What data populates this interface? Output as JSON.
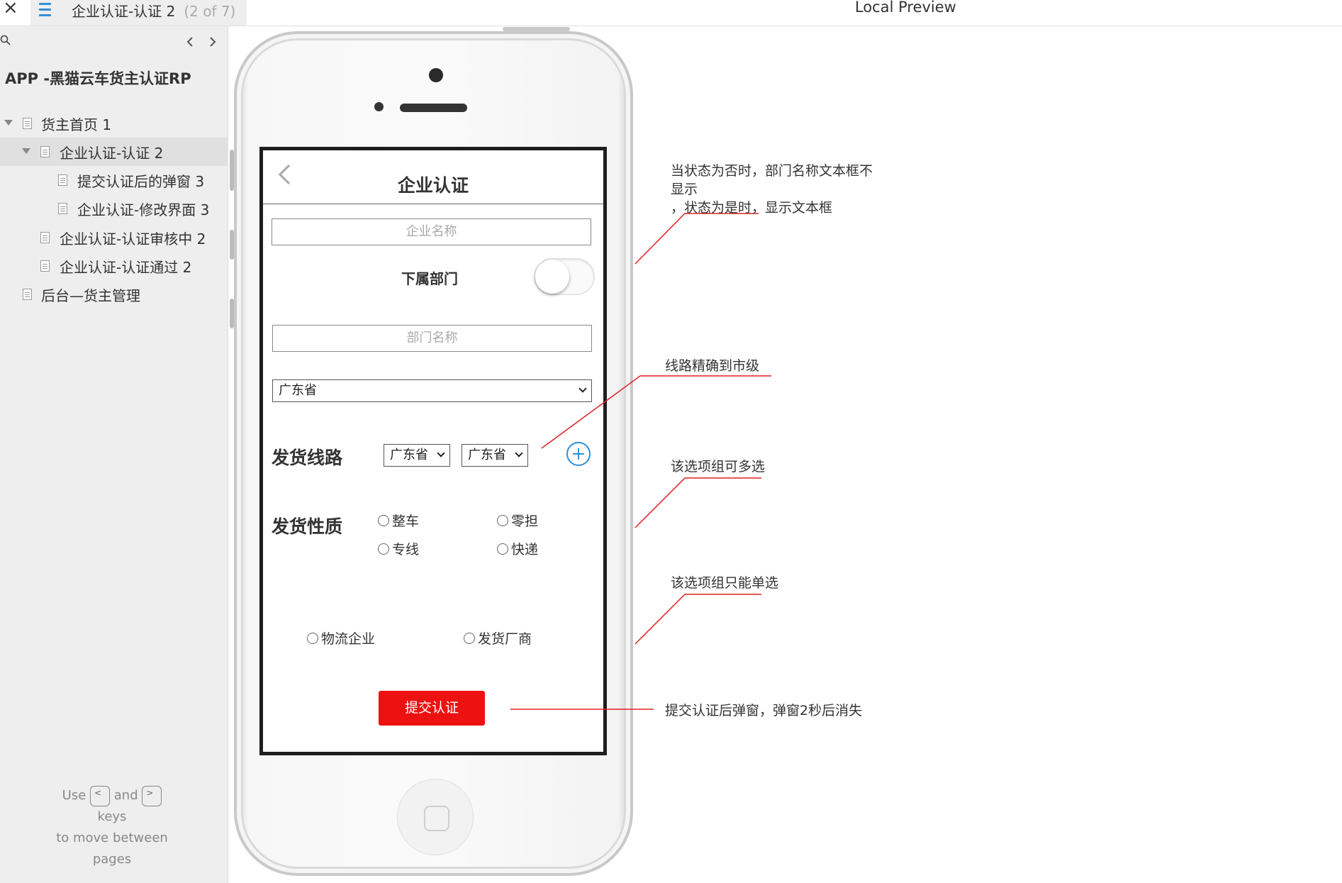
{
  "topbar": {
    "close_glyph": "×",
    "tab_title": "企业认证-认证 2",
    "tab_count": "(2 of 7)",
    "preview_title": "Local Preview"
  },
  "sidebar": {
    "project_title": "APP -黑猫云车货主认证RP",
    "items": [
      {
        "label": "货主首页 1"
      },
      {
        "label": "企业认证-认证 2"
      },
      {
        "label": "提交认证后的弹窗 3"
      },
      {
        "label": "企业认证-修改界面 3"
      },
      {
        "label": "企业认证-认证审核中 2"
      },
      {
        "label": "企业认证-认证通过 2"
      },
      {
        "label": "后台—货主管理"
      }
    ],
    "help": {
      "use": "Use",
      "key_prev": "<",
      "and": "and",
      "key_next": ">",
      "keys": "keys",
      "line3": "to move between",
      "line4": "pages"
    }
  },
  "screen": {
    "title": "企业认证",
    "company_name_placeholder": "企业名称",
    "sub_dept_label": "下属部门",
    "dept_name_placeholder": "部门名称",
    "province_select": "广东省",
    "route_label": "发货线路",
    "route_from": "广东省",
    "route_to": "广东省",
    "nature_label": "发货性质",
    "nature_options": [
      "整车",
      "零担",
      "专线",
      "快递"
    ],
    "type_options": [
      "物流企业",
      "发货厂商"
    ],
    "submit_label": "提交认证"
  },
  "annotations": {
    "dept_toggle_line1": "当状态为否时，部门名称文本框不",
    "dept_toggle_line2": "显示",
    "dept_toggle_line3": "，状态为是时，显示文本框",
    "route_precision": "线路精确到市级",
    "multi_select": "该选项组可多选",
    "single_select": "该选项组只能单选",
    "submit_popup": "提交认证后弹窗，弹窗2秒后消失"
  },
  "colors": {
    "accent_blue": "#2f8fd9",
    "submit_red": "#ee1111",
    "annotation_line": "#e02020"
  }
}
